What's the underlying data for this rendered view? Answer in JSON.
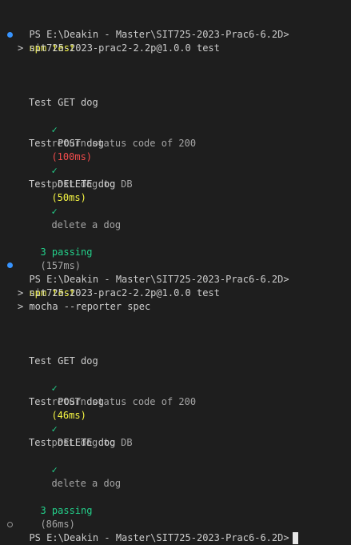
{
  "colors": {
    "background": "#1e1e1e",
    "text": "#cccccc",
    "success": "#23d18b",
    "slow_medium": "#f5f543",
    "slow_high": "#f14c4c",
    "decoration_success": "#3794ff",
    "decoration_idle": "#909090"
  },
  "prompt": "PS E:\\Deakin - Master\\SIT725-2023-Prac6-6.2D>",
  "command": "npm test",
  "run1": {
    "script_line": "> sit725-2023-prac2-2.2p@1.0.0 test",
    "suites": [
      {
        "title": "Test GET dog",
        "check": "✓",
        "test": "return status code of 200",
        "duration": "(100ms)"
      },
      {
        "title": "Test POST dog",
        "check": "✓",
        "test": "post dog to DB",
        "duration": "(50ms)"
      },
      {
        "title": "Test DELETE dog",
        "check": "✓",
        "test": "delete a dog",
        "duration": ""
      }
    ],
    "passing_label": "3 passing",
    "passing_time": "(157ms)"
  },
  "run2": {
    "script_line": "> sit725-2023-prac2-2.2p@1.0.0 test",
    "mocha_line": "> mocha --reporter spec",
    "suites": [
      {
        "title": "Test GET dog",
        "check": "✓",
        "test": "return status code of 200",
        "duration": "(46ms)"
      },
      {
        "title": "Test POST dog",
        "check": "✓",
        "test": "post dog to DB",
        "duration": ""
      },
      {
        "title": "Test DELETE dog",
        "check": "✓",
        "test": "delete a dog",
        "duration": ""
      }
    ],
    "passing_label": "3 passing",
    "passing_time": "(86ms)"
  }
}
